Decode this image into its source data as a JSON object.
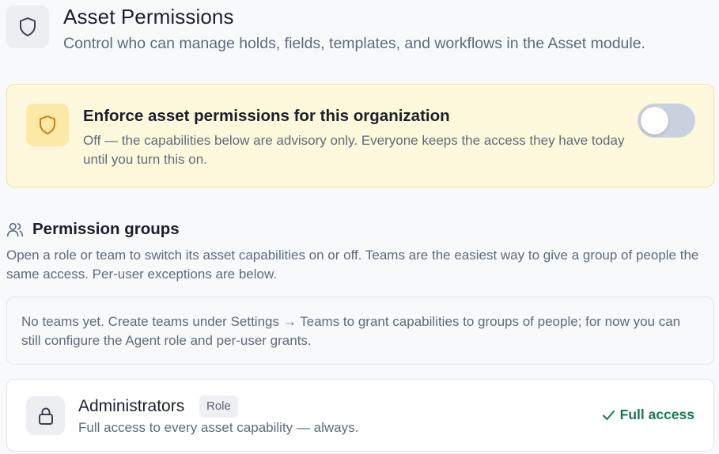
{
  "header": {
    "icon": "shield-icon",
    "title": "Asset Permissions",
    "subtitle": "Control who can manage holds, fields, templates, and workflows in the Asset module."
  },
  "enforce": {
    "icon": "shield-icon",
    "title": "Enforce asset permissions for this organization",
    "description": "Off — the capabilities below are advisory only. Everyone keeps the access they have today until you turn this on.",
    "toggle_on": false,
    "accent_color": "#d97706"
  },
  "permission_groups": {
    "icon": "users-icon",
    "title": "Permission groups",
    "description": "Open a role or team to switch its asset capabilities on or off. Teams are the easiest way to give a group of people the same access. Per-user exceptions are below.",
    "empty_note": "No teams yet. Create teams under Settings → Teams to grant capabilities to groups of people; for now you can still configure the Agent role and per-user grants."
  },
  "groups": [
    {
      "icon": "lock-icon",
      "name": "Administrators",
      "badge": "Role",
      "description": "Full access to every asset capability — always.",
      "status": "Full access",
      "status_icon": "check-icon",
      "status_color": "#177a4f"
    }
  ]
}
